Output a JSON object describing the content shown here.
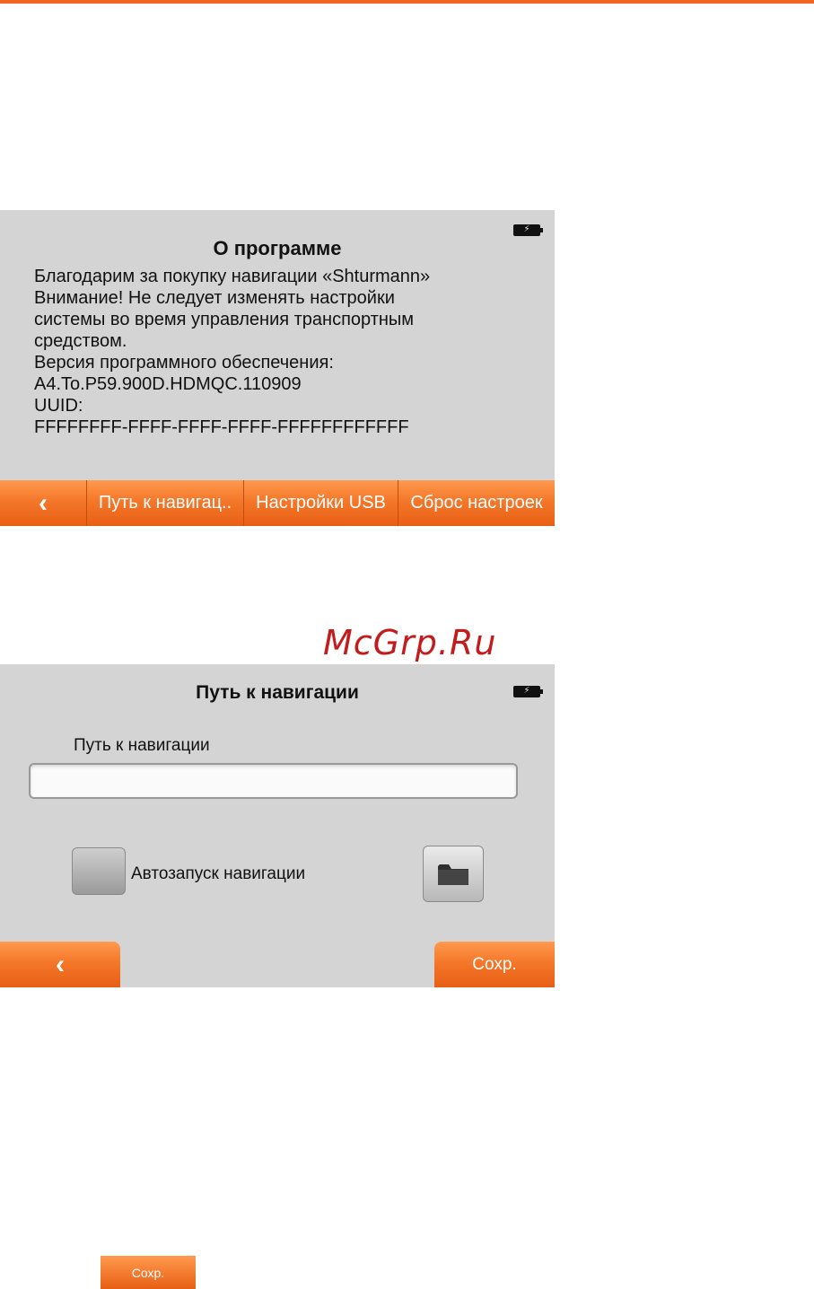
{
  "about_screen": {
    "title": "О программе",
    "lines": [
      "Благодарим за покупку навигации «Shturmann»",
      "Внимание! Не следует изменять настройки",
      "системы во время управления транспортным",
      "средством.",
      "Версия программного обеспечения:",
      "A4.To.P59.900D.HDMQC.110909",
      "UUID:",
      "FFFFFFFF-FFFF-FFFF-FFFF-FFFFFFFFFFFF"
    ],
    "toolbar": {
      "back_icon": "chevron-left-icon",
      "nav_path_label": "Путь к навигац..",
      "usb_settings_label": "Настройки USB",
      "reset_label": "Сброс настроек"
    }
  },
  "watermark": "McGrp.Ru",
  "path_screen": {
    "title": "Путь к навигации",
    "field_label": "Путь к навигации",
    "field_value": "",
    "autostart_label": "Автозапуск навигации",
    "autostart_checked": false,
    "folder_icon": "folder-icon",
    "save_label": "Сохр."
  },
  "sample_save_label": "Сохр.",
  "colors": {
    "accent": "#f26522",
    "button_orange": "#f4772a",
    "screen_bg": "#d4d4d4"
  }
}
